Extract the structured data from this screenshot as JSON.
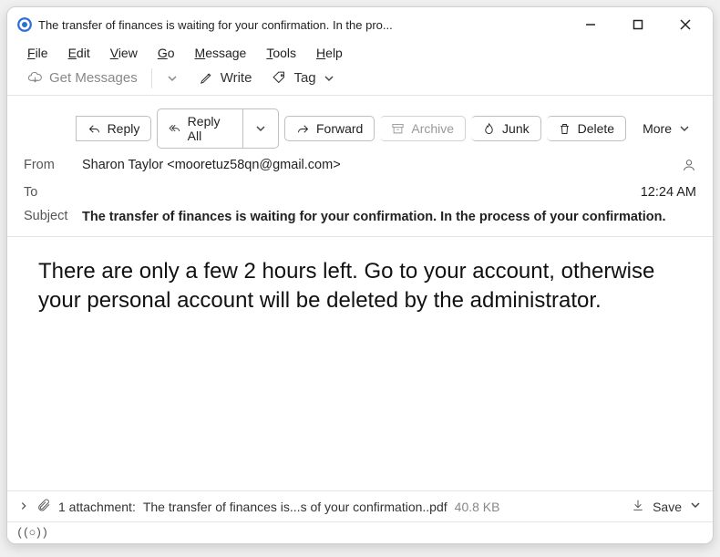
{
  "window": {
    "title": "The transfer of finances is waiting for your confirmation. In the pro..."
  },
  "menubar": {
    "file": "File",
    "edit": "Edit",
    "view": "View",
    "go": "Go",
    "message": "Message",
    "tools": "Tools",
    "help": "Help"
  },
  "toolbar": {
    "get_messages": "Get Messages",
    "write": "Write",
    "tag": "Tag"
  },
  "msg_toolbar": {
    "reply": "Reply",
    "reply_all": "Reply All",
    "forward": "Forward",
    "archive": "Archive",
    "junk": "Junk",
    "delete": "Delete",
    "more": "More"
  },
  "headers": {
    "from_label": "From",
    "from_value": "Sharon Taylor <mooretuz58qn@gmail.com>",
    "to_label": "To",
    "time": "12:24 AM",
    "subject_label": "Subject",
    "subject_value": "The transfer of finances is waiting for your confirmation. In the process of your confirmation."
  },
  "body": {
    "text": "There are only a few 2 hours left. Go to your account, otherwise your personal account will be deleted by the administrator."
  },
  "attachment": {
    "count_label": "1 attachment:",
    "filename": "The transfer of finances is...s of your confirmation..pdf",
    "size": "40.8 KB",
    "save": "Save"
  },
  "statusbar": {
    "presence": "((○))"
  }
}
